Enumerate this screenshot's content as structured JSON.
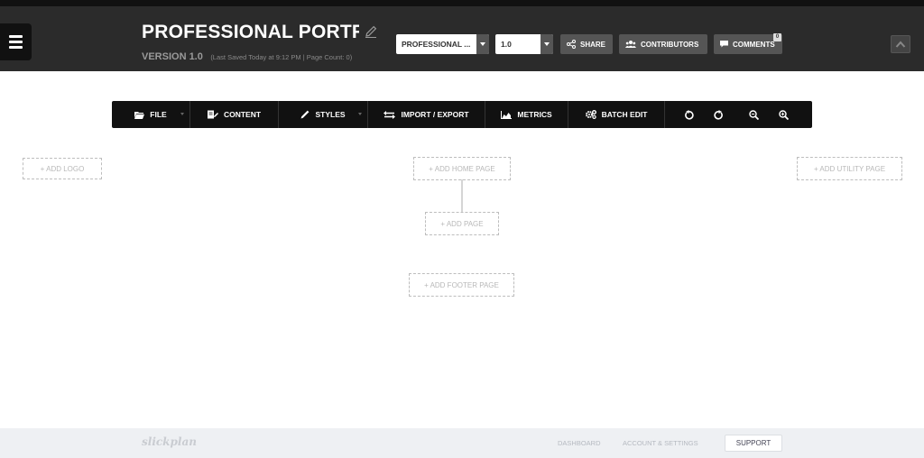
{
  "header": {
    "project_title": "PROFESSIONAL PORTFO",
    "version": "VERSION 1.0",
    "last_saved": "(Last Saved Today at 9:12 PM  |  Page Count: 0)",
    "project_select": "PROFESSIONAL ...",
    "version_select": "1.0",
    "share_label": "SHARE",
    "contributors_label": "CONTRIBUTORS",
    "comments_label": "COMMENTS",
    "comments_count": "0"
  },
  "toolbar": {
    "file_label": "FILE",
    "content_label": "CONTENT",
    "styles_label": "STYLES",
    "import_export_label": "IMPORT / EXPORT",
    "metrics_label": "METRICS",
    "batch_edit_label": "BATCH EDIT"
  },
  "sitemap": {
    "add_logo": "+  ADD LOGO",
    "add_home_page": "+ ADD HOME PAGE",
    "add_utility_page": "+ ADD UTILITY PAGE",
    "add_page": "+ ADD PAGE",
    "add_footer_page": "+ ADD FOOTER PAGE"
  },
  "footer": {
    "logo": "slickplan",
    "dashboard": "DASHBOARD",
    "account_settings": "ACCOUNT & SETTINGS",
    "support": "SUPPORT"
  },
  "colors": {
    "header_bg": "#2b2b2b",
    "toolbar_bg": "#111111",
    "button_bg": "#555555",
    "footer_bg": "#eef0f3"
  }
}
